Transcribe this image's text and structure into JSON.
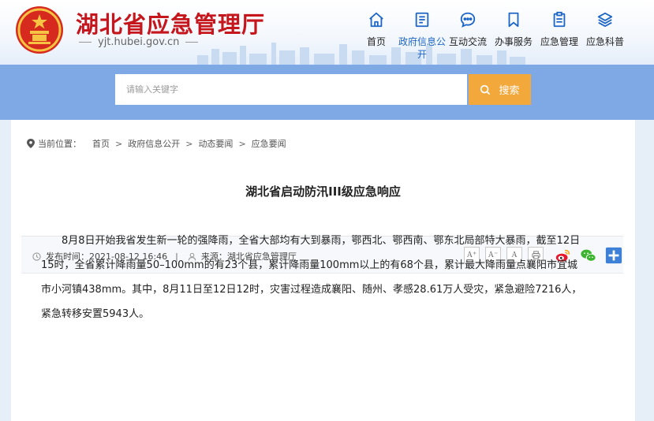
{
  "header": {
    "site_title": "湖北省应急管理厅",
    "site_domain": "yjt.hubei.gov.cn"
  },
  "nav": [
    {
      "label": "首页",
      "icon": "home-icon"
    },
    {
      "label": "政府信息公开",
      "icon": "document-icon",
      "active": true
    },
    {
      "label": "互动交流",
      "icon": "chat-icon"
    },
    {
      "label": "办事服务",
      "icon": "bookmark-icon"
    },
    {
      "label": "应急管理",
      "icon": "clipboard-icon"
    },
    {
      "label": "应急科普",
      "icon": "layers-icon"
    }
  ],
  "search": {
    "placeholder": "请输入关键字",
    "button_label": "搜索"
  },
  "breadcrumb": {
    "label": "当前位置：",
    "items": [
      "首页",
      "政府信息公开",
      "动态要闻",
      "应急要闻"
    ],
    "separator": ">"
  },
  "article": {
    "title": "湖北省启动防汛III级应急响应",
    "publish_label": "发布时间：",
    "publish_time": "2021-08-12 16:46",
    "divider": "|",
    "source_label": "来源：",
    "source": "湖北省应急管理厅",
    "font_sizes": [
      "A⁺",
      "A⁻",
      "A"
    ],
    "paragraph": "8月8日开始我省发生新一轮的强降雨，全省大部均有大到暴雨，鄂西北、鄂西南、鄂东北局部特大暴雨，截至12日15时，全省累计降雨量50–100mm的有23个县，累计降雨量100mm以上的有68个县，累计最大降雨量点襄阳市宜城市小河镇438mm。其中，8月11日至12日12时，灾害过程造成襄阳、随州、孝感28.61万人受灾，紧急避险7216人，紧急转移安置5943人。"
  },
  "colors": {
    "brand_red": "#c4161c",
    "nav_active": "#1e66c6",
    "search_band": "#7fa9e4",
    "search_button": "#f3a83c",
    "page_bg": "#e6eef8"
  }
}
